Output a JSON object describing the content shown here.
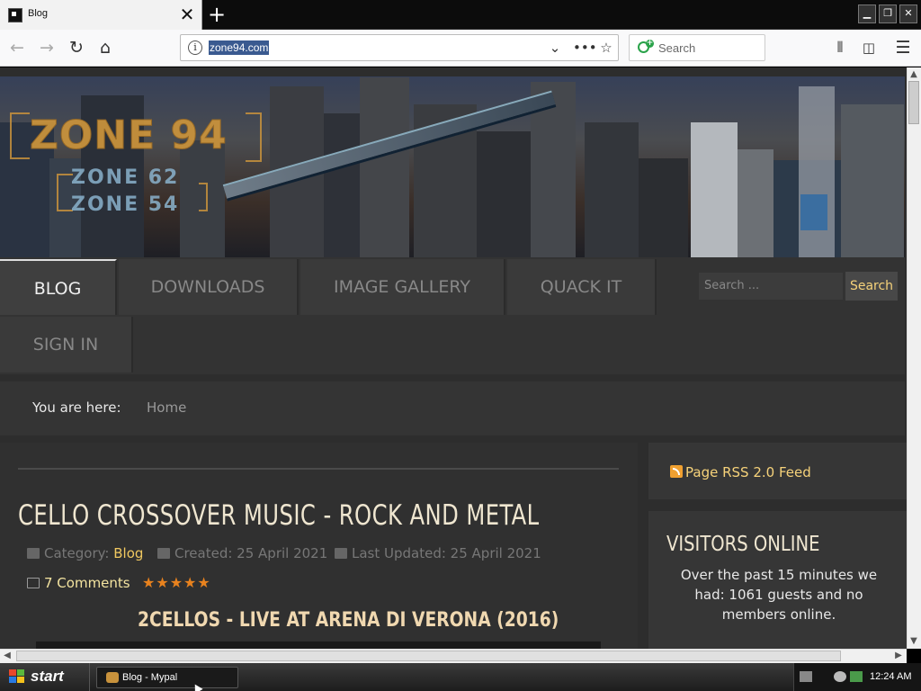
{
  "browser": {
    "tab_title": "Blog",
    "new_tab_label": "+",
    "url": "zone94.com",
    "search_placeholder": "Search"
  },
  "site": {
    "logo_lines": [
      "ZONE 94",
      "ZONE 62",
      "ZONE 54"
    ],
    "menu": [
      {
        "label": "BLOG",
        "active": true
      },
      {
        "label": "DOWNLOADS",
        "active": false
      },
      {
        "label": "IMAGE GALLERY",
        "active": false
      },
      {
        "label": "QUACK IT",
        "active": false
      },
      {
        "label": "SIGN IN",
        "active": false
      }
    ],
    "search_placeholder": "Search ...",
    "search_button": "Search",
    "breadcrumb": {
      "label": "You are here:",
      "home": "Home"
    }
  },
  "article": {
    "title": "CELLO CROSSOVER MUSIC - ROCK AND METAL",
    "category_label": "Category:",
    "category": "Blog",
    "created": "Created: 25 April 2021",
    "updated": "Last Updated: 25 April 2021",
    "comments": "7 Comments",
    "rating": "★★★★★",
    "rating_value": 5,
    "subtitle": "2CELLOS - LIVE AT ARENA DI VERONA (2016)"
  },
  "sidebar": {
    "rss": "Page RSS 2.0 Feed",
    "visitors_title": "VISITORS ONLINE",
    "visitors_text": "Over the past 15 minutes we had: 1061 guests and no members online."
  },
  "taskbar": {
    "start_label": "start",
    "task_label": "Blog - Mypal",
    "clock": "12:24 AM"
  },
  "colors": {
    "accent_gold": "#f6d27a",
    "rating_orange": "#e8821e",
    "page_bg": "#2d2d2d",
    "selection": "#3a5a90"
  }
}
